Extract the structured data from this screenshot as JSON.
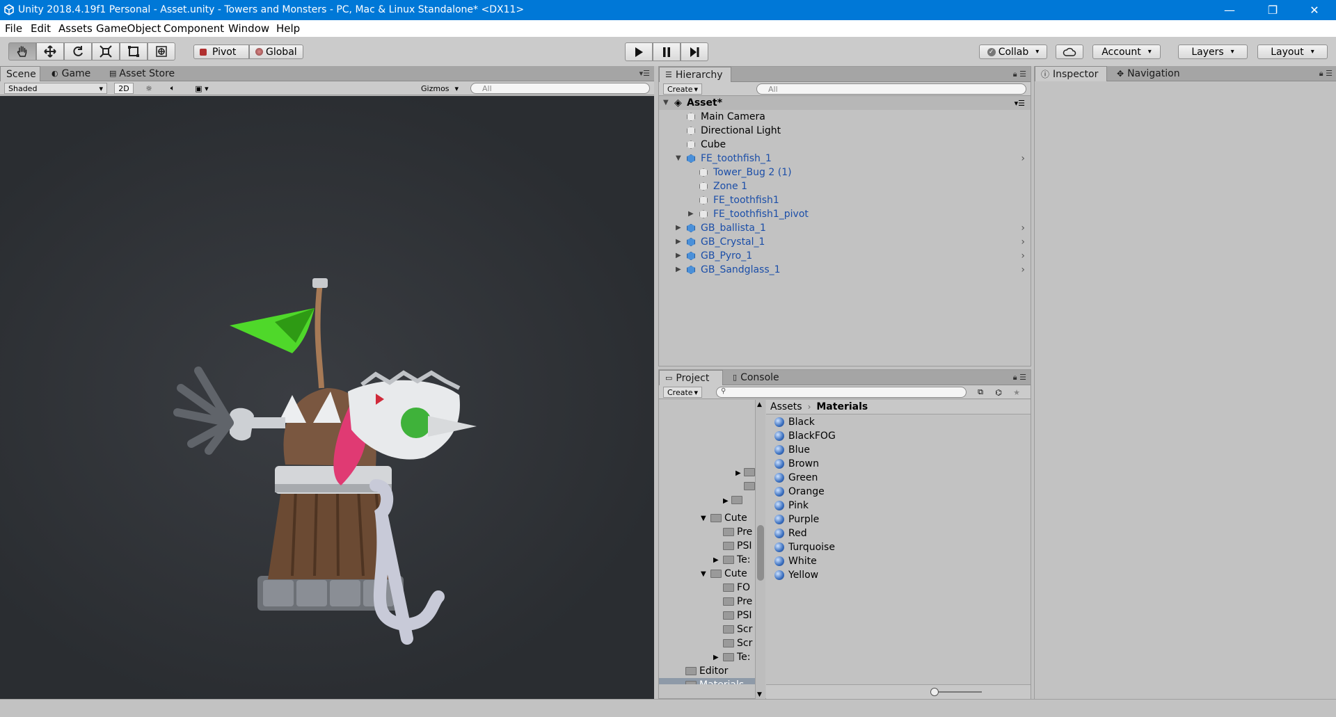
{
  "window": {
    "title": "Unity 2018.4.19f1 Personal - Asset.unity - Towers and Monsters - PC, Mac & Linux Standalone* <DX11>",
    "controls": [
      "—",
      "❐",
      "✕"
    ]
  },
  "menu": [
    "File",
    "Edit",
    "Assets",
    "GameObject",
    "Component",
    "Window",
    "Help"
  ],
  "toolbar": {
    "pivot": "Pivot",
    "global": "Global",
    "collab": "Collab",
    "account": "Account",
    "layers": "Layers",
    "layout": "Layout"
  },
  "scene": {
    "tabs": [
      "Scene",
      "Game",
      "Asset Store"
    ],
    "shading": "Shaded",
    "mode_2d": "2D",
    "gizmos": "Gizmos",
    "search_placeholder": "All"
  },
  "hierarchy": {
    "tab": "Hierarchy",
    "create": "Create",
    "search_placeholder": "All",
    "scene_name": "Asset*",
    "items": [
      {
        "label": "Main Camera",
        "depth": 0,
        "prefab": false
      },
      {
        "label": "Directional Light",
        "depth": 0,
        "prefab": false
      },
      {
        "label": "Cube",
        "depth": 0,
        "prefab": false
      },
      {
        "label": "FE_toothfish_1",
        "depth": 0,
        "prefab": true,
        "expanded": true
      },
      {
        "label": "Tower_Bug 2 (1)",
        "depth": 1,
        "prefab": false
      },
      {
        "label": "Zone 1",
        "depth": 1,
        "prefab": false
      },
      {
        "label": "FE_toothfish1",
        "depth": 1,
        "prefab": false
      },
      {
        "label": "FE_toothfish1_pivot",
        "depth": 1,
        "prefab": false,
        "collapsed": true
      },
      {
        "label": "GB_ballista_1",
        "depth": 0,
        "prefab": true,
        "collapsed": true
      },
      {
        "label": "GB_Crystal_1",
        "depth": 0,
        "prefab": true,
        "collapsed": true
      },
      {
        "label": "GB_Pyro_1",
        "depth": 0,
        "prefab": true,
        "collapsed": true
      },
      {
        "label": "GB_Sandglass_1",
        "depth": 0,
        "prefab": true,
        "collapsed": true
      }
    ]
  },
  "project": {
    "tabs": [
      "Project",
      "Console"
    ],
    "create": "Create",
    "breadcrumb": [
      "Assets",
      "Materials"
    ],
    "tree": [
      {
        "label": "Cute",
        "depth": 1,
        "open": true
      },
      {
        "label": "Pre",
        "depth": 2
      },
      {
        "label": "PSI",
        "depth": 2
      },
      {
        "label": "Te:",
        "depth": 2,
        "closed": true
      },
      {
        "label": "Cute",
        "depth": 1,
        "open": true
      },
      {
        "label": "FO",
        "depth": 2
      },
      {
        "label": "Pre",
        "depth": 2
      },
      {
        "label": "PSI",
        "depth": 2
      },
      {
        "label": "Scr",
        "depth": 2
      },
      {
        "label": "Scr",
        "depth": 2
      },
      {
        "label": "Te:",
        "depth": 2,
        "closed": true
      },
      {
        "label": "Editor",
        "depth": 0
      },
      {
        "label": "Materials",
        "depth": 0,
        "selected": true
      }
    ],
    "materials": [
      "Black",
      "BlackFOG",
      "Blue",
      "Brown",
      "Green",
      "Orange",
      "Pink",
      "Purple",
      "Red",
      "Turquoise",
      "White",
      "Yellow"
    ]
  },
  "inspector": {
    "tabs": [
      "Inspector",
      "Navigation"
    ]
  },
  "colors": {
    "titlebar": "#0078d7",
    "viewport": "#2f3236",
    "prefab_blue": "#1b4ea8"
  }
}
